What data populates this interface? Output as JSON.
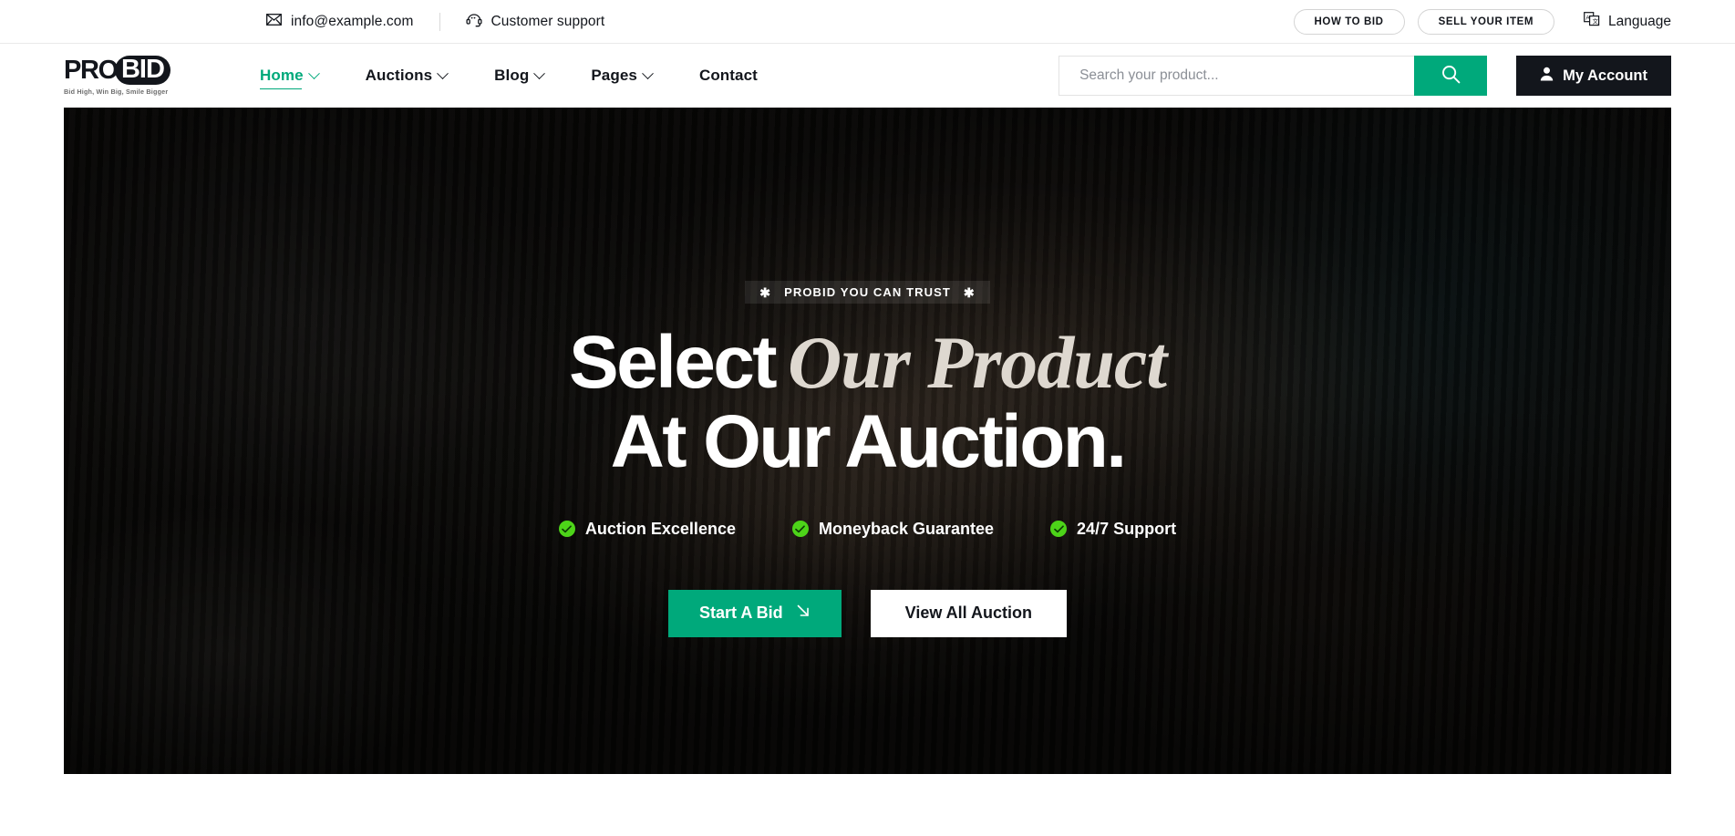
{
  "topbar": {
    "email": "info@example.com",
    "email_icon": "envelope-icon",
    "support": "Customer support",
    "support_icon": "headset-icon",
    "how_to_bid": "HOW TO BID",
    "sell_your_item": "SELL YOUR ITEM",
    "language": "Language",
    "language_icon": "translate-icon"
  },
  "header": {
    "logo": {
      "pro": "PRO",
      "bid": "BID",
      "tagline": "Bid High, Win Big, Smile Bigger"
    },
    "nav": [
      {
        "label": "Home",
        "has_dropdown": true,
        "active": true
      },
      {
        "label": "Auctions",
        "has_dropdown": true,
        "active": false
      },
      {
        "label": "Blog",
        "has_dropdown": true,
        "active": false
      },
      {
        "label": "Pages",
        "has_dropdown": true,
        "active": false
      },
      {
        "label": "Contact",
        "has_dropdown": false,
        "active": false
      }
    ],
    "search": {
      "value": "",
      "placeholder": "Search your product...",
      "icon": "search-icon"
    },
    "account": {
      "label": "My Account",
      "icon": "user-icon"
    }
  },
  "hero": {
    "badge": "PROBID YOU CAN TRUST",
    "badge_icon": "sparkle-icon",
    "heading_line1_plain": "Select",
    "heading_line1_emph": "Our Product",
    "heading_line2": "At Our Auction.",
    "features": [
      {
        "label": "Auction Excellence",
        "icon": "check-circle-icon"
      },
      {
        "label": "Moneyback Guarantee",
        "icon": "check-circle-icon"
      },
      {
        "label": "24/7 Support",
        "icon": "check-circle-icon"
      }
    ],
    "cta_primary": {
      "label": "Start A Bid",
      "icon": "arrow-down-right-icon"
    },
    "cta_secondary": {
      "label": "View All Auction"
    }
  },
  "colors": {
    "accent": "#00a97b",
    "dark": "#13161c",
    "check_green": "#4dd419",
    "emph_text": "#ded8d0"
  }
}
